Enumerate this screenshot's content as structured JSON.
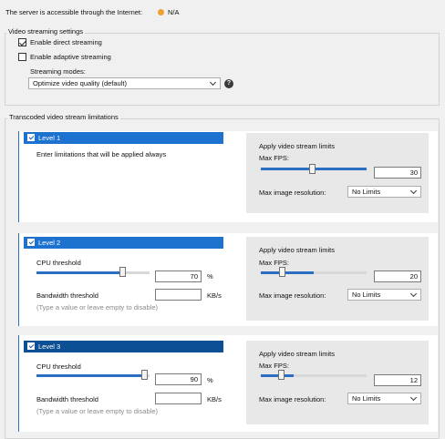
{
  "server": {
    "label": "The server is accessible through the Internet:",
    "status": "N/A",
    "status_color": "#f0a030"
  },
  "video_settings": {
    "title": "Video streaming settings",
    "direct": {
      "label": "Enable direct streaming",
      "checked": true
    },
    "adaptive": {
      "label": "Enable adaptive streaming",
      "checked": false
    },
    "modes_label": "Streaming modes:",
    "modes_value": "Optimize video quality (default)",
    "help_icon": "help-icon"
  },
  "transcoded": {
    "title": "Transcoded video stream limitations",
    "levels": [
      {
        "title": "Level 1",
        "description": "Enter limitations that will be applied always",
        "apply_label": "Apply video stream limits",
        "fps_label": "Max FPS:",
        "fps_value": "30",
        "res_label": "Max image resolution:",
        "res_value": "No Limits"
      },
      {
        "title": "Level 2",
        "cpu_label": "CPU threshold",
        "cpu_value": "70",
        "cpu_unit": "%",
        "bw_label": "Bandwidth threshold",
        "bw_value": "",
        "bw_unit": "KB/s",
        "bw_hint": "(Type a value or leave empty to disable)",
        "apply_label": "Apply video stream limits",
        "fps_label": "Max FPS:",
        "fps_value": "20",
        "res_label": "Max image resolution:",
        "res_value": "No Limits"
      },
      {
        "title": "Level 3",
        "cpu_label": "CPU threshold",
        "cpu_value": "90",
        "cpu_unit": "%",
        "bw_label": "Bandwidth threshold",
        "bw_value": "",
        "bw_unit": "KB/s",
        "bw_hint": "(Type a value or leave empty to disable)",
        "apply_label": "Apply video stream limits",
        "fps_label": "Max FPS:",
        "fps_value": "12",
        "res_label": "Max image resolution:",
        "res_value": "No Limits"
      }
    ]
  },
  "colors": {
    "accent": "#2a6fc4",
    "header_active": "#0d4f95",
    "header": "#1d72d0"
  }
}
